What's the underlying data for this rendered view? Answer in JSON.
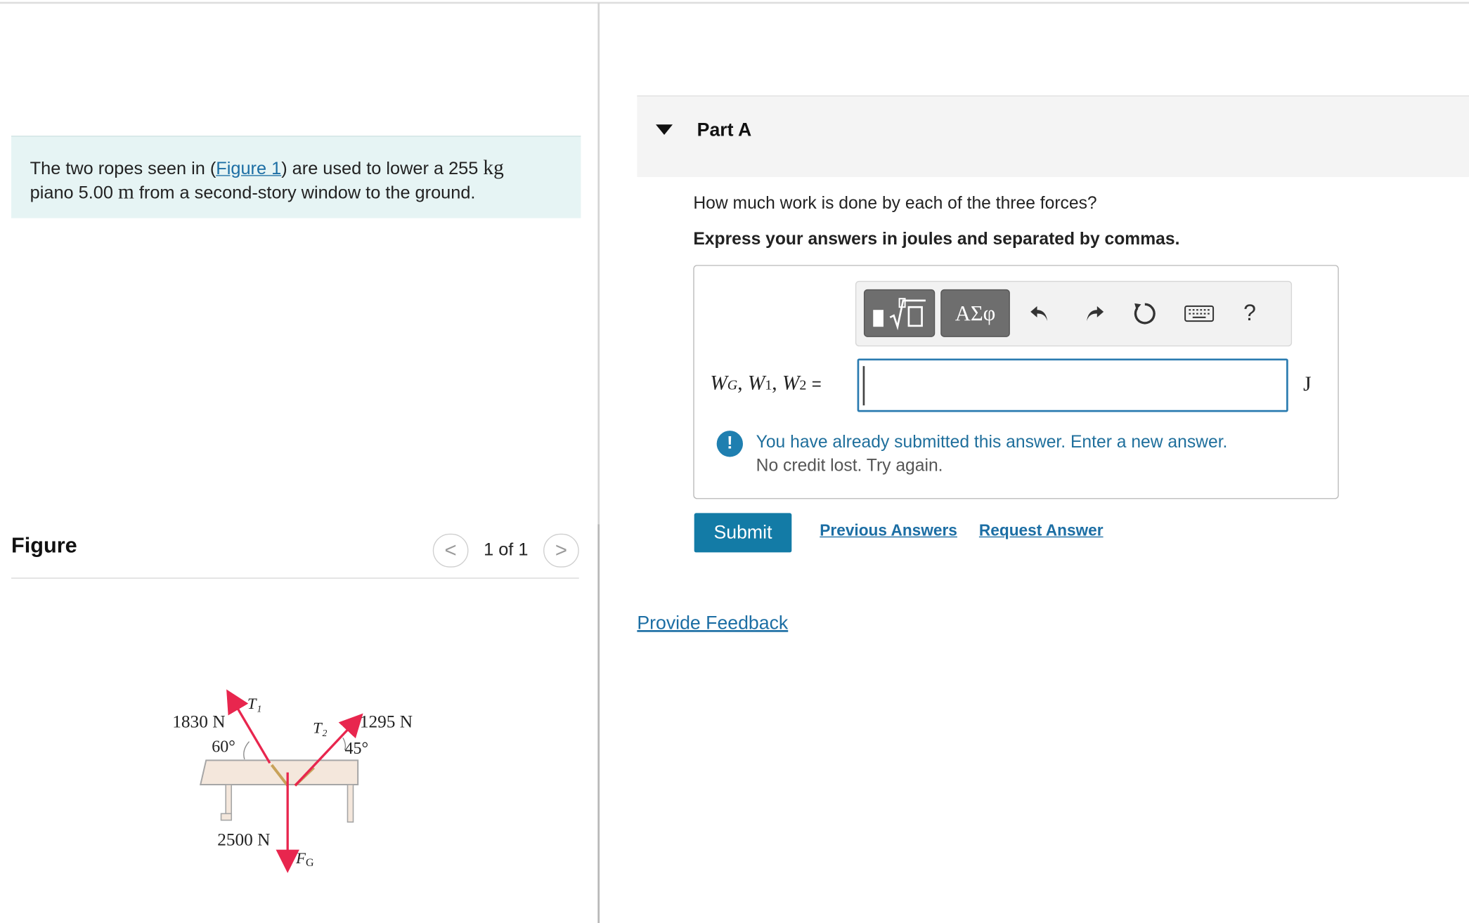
{
  "problem": {
    "text_before_link": "The two ropes seen in (",
    "link": "Figure 1",
    "text_after_link": ") are used to lower a 255 ",
    "mass_unit": "kg",
    "line2_start": "piano 5.00 ",
    "distance_unit": "m",
    "line2_end": " from a second-story window to the ground."
  },
  "figure_panel": {
    "heading": "Figure",
    "pager_prev": "<",
    "pager_text": "1 of 1",
    "pager_next": ">"
  },
  "figure": {
    "t1_force": "1830 N",
    "t1_angle": "60°",
    "t1_label": "T₁",
    "t2_force": "1295 N",
    "t2_angle": "45°",
    "t2_label": "T₂",
    "fg_force": "2500 N",
    "fg_label": "F",
    "fg_sub": "G",
    "colors": {
      "arrow": "#e8264e",
      "piano": "#f4e7dc",
      "outline": "#a6a6a6",
      "rope": "#c8a25a"
    }
  },
  "part_a": {
    "title": "Part A",
    "question": "How much work is done by each of the three forces?",
    "instruction": "Express your answers in joules and separated by commas.",
    "toolbar": {
      "template_icon": "template-icon",
      "greek": "ΑΣφ",
      "undo_icon": "undo-icon",
      "redo_icon": "redo-icon",
      "reset_icon": "reset-icon",
      "keyboard_icon": "keyboard-icon",
      "help": "?"
    },
    "answer": {
      "w": "W",
      "g": "G",
      "one": "1",
      "two": "2",
      "comma": ", ",
      "equals": "=",
      "value": "",
      "unit": "J"
    },
    "notice_icon": "!",
    "notice_line1": "You have already submitted this answer. Enter a new answer.",
    "notice_line2": "No credit lost. Try again.",
    "submit": "Submit",
    "previous_answers": "Previous Answers",
    "request_answer": "Request Answer"
  },
  "feedback": "Provide Feedback"
}
